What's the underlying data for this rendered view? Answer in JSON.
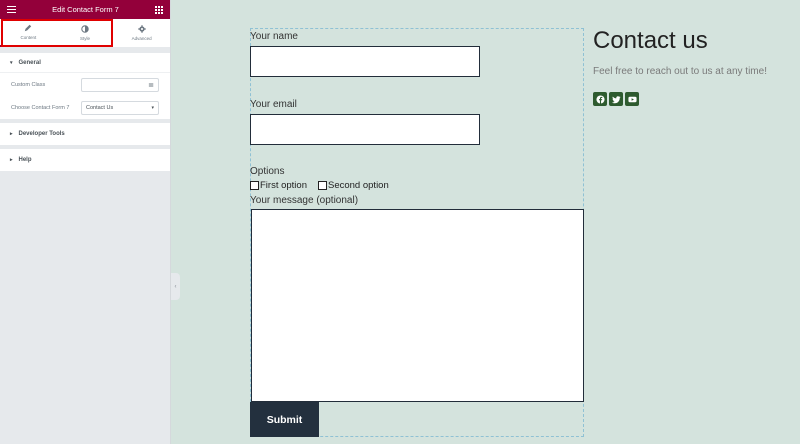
{
  "panel": {
    "title": "Edit Contact Form 7",
    "tabs": [
      {
        "label": "Content",
        "icon": "pencil-icon"
      },
      {
        "label": "Style",
        "icon": "half-circle-icon"
      },
      {
        "label": "Advanced",
        "icon": "gear-icon"
      }
    ],
    "active_tab": "Content",
    "sections": {
      "general": {
        "title": "General",
        "custom_class_label": "Custom Class",
        "custom_class_value": "",
        "choose_form_label": "Choose Contact Form 7",
        "choose_form_value": "Contact Us"
      },
      "developer_tools": {
        "title": "Developer Tools"
      },
      "help": {
        "title": "Help"
      }
    }
  },
  "form": {
    "name_label": "Your name",
    "email_label": "Your email",
    "options_label": "Options",
    "option_1": "First option",
    "option_2": "Second option",
    "message_label": "Your message (optional)",
    "submit_label": "Submit"
  },
  "contact": {
    "title": "Contact us",
    "subtitle": "Feel free to reach out to us at any time!",
    "social_icons": [
      "facebook-icon",
      "twitter-icon",
      "youtube-icon"
    ]
  },
  "colors": {
    "header_bg": "#93003a",
    "page_bg": "#d4e3dd",
    "submit_bg": "#23303e",
    "social_bg": "#2e5b2f",
    "highlight": "#e00000"
  }
}
